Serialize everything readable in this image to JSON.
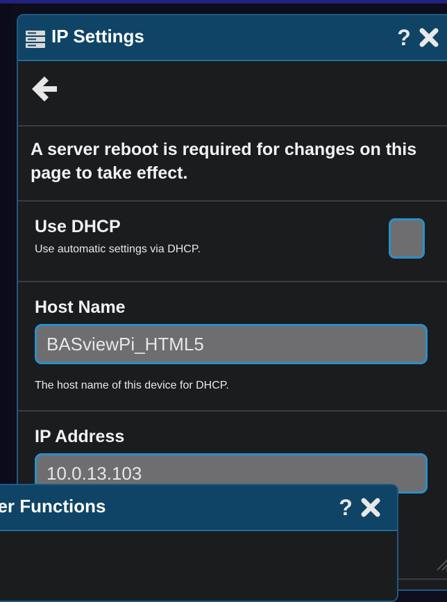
{
  "dialog": {
    "title": "IP Settings",
    "title_icon": "server-icon",
    "help_label": "?",
    "close_icon": "close-icon",
    "back_icon": "back-arrow-icon",
    "notice": "A server reboot is required for changes on this page to take effect.",
    "settings": {
      "dhcp": {
        "label": "Use DHCP",
        "description": "Use automatic settings via DHCP.",
        "checked": false
      },
      "host_name": {
        "label": "Host Name",
        "value": "BASviewPi_HTML5",
        "description": "The host name of this device for DHCP."
      },
      "ip_address": {
        "label": "IP Address",
        "value": "10.0.13.103"
      }
    }
  },
  "second_dialog": {
    "title": "ver Functions",
    "help_label": "?",
    "close_icon": "close-icon"
  },
  "colors": {
    "titlebar": "#0f4466",
    "accent_border": "#2b8fc9",
    "panel_bg": "#1b1c1e",
    "field_bg": "#6e6e70"
  }
}
